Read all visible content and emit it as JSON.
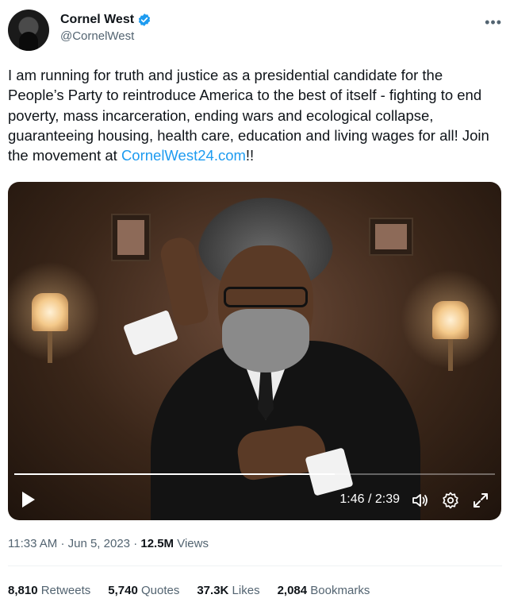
{
  "author": {
    "display_name": "Cornel West",
    "handle": "@CornelWest",
    "verified_color": "#1d9bf0",
    "avatar_icon": "profile-photo"
  },
  "tweet": {
    "text_before_link": "I am running for truth and justice as a presidential candidate for the People’s Party to reintroduce America to the best of itself - fighting to end poverty, mass incarceration, ending wars and ecological collapse, guaranteeing housing, health care, education and living wages for all! Join the movement at ",
    "link_text": "CornelWest24.com",
    "text_after_link": "!!"
  },
  "video": {
    "current_time": "1:46",
    "duration": "2:39",
    "time_display": "1:46 / 2:39",
    "progress_fraction": 0.667,
    "icons": [
      "play-icon",
      "volume-icon",
      "settings-icon",
      "fullscreen-icon"
    ]
  },
  "meta": {
    "time": "11:33 AM",
    "date": "Jun 5, 2023",
    "views_count": "12.5M",
    "views_label": "Views"
  },
  "stats": {
    "retweets_count": "8,810",
    "retweets_label": "Retweets",
    "quotes_count": "5,740",
    "quotes_label": "Quotes",
    "likes_count": "37.3K",
    "likes_label": "Likes",
    "bookmarks_count": "2,084",
    "bookmarks_label": "Bookmarks"
  },
  "colors": {
    "link": "#1d9bf0",
    "secondary_text": "#536471",
    "primary_text": "#0f1419"
  }
}
